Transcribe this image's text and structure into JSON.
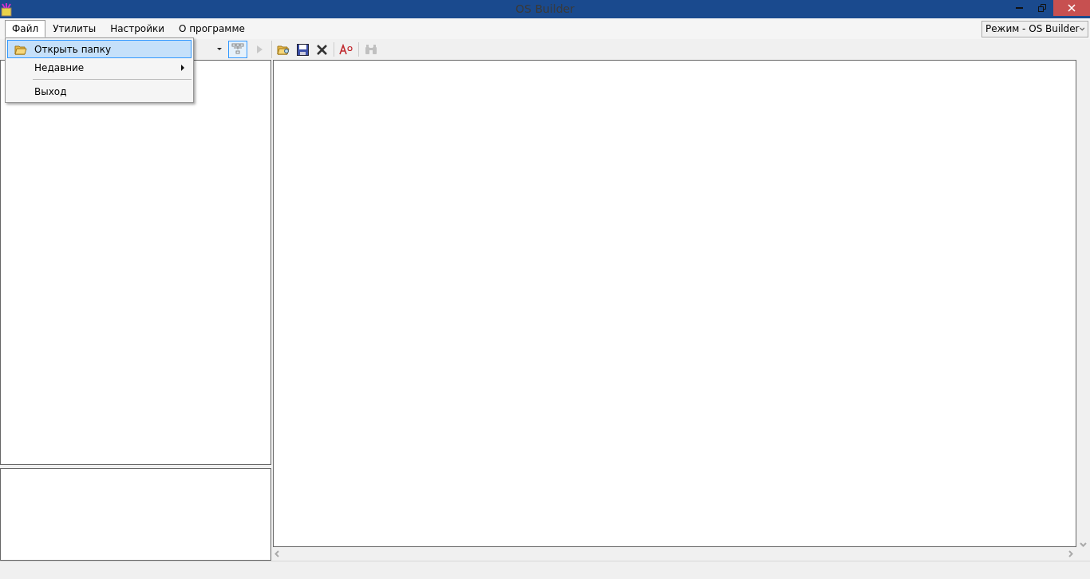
{
  "window": {
    "title": "OS Builder"
  },
  "menu": [
    {
      "label": "Файл",
      "selected": true
    },
    {
      "label": "Утилиты",
      "selected": false
    },
    {
      "label": "Настройки",
      "selected": false
    },
    {
      "label": "О программе",
      "selected": false
    }
  ],
  "mode_select": {
    "value": "Режим - OS Builder"
  },
  "file_menu": [
    {
      "kind": "open",
      "label": "Открыть папку",
      "selected": true
    },
    {
      "kind": "submenu",
      "label": "Недавние",
      "selected": false
    },
    {
      "kind": "separator"
    },
    {
      "kind": "item",
      "label": "Выход",
      "selected": false
    }
  ],
  "left_tools": [
    {
      "kind": "tree",
      "checked": true,
      "disabled": false
    },
    {
      "kind": "play",
      "checked": false,
      "disabled": true
    }
  ],
  "editor_tools": [
    {
      "kind": "open",
      "disabled": false
    },
    {
      "kind": "save",
      "disabled": false
    },
    {
      "kind": "delete",
      "disabled": false
    },
    {
      "kind": "sep"
    },
    {
      "kind": "font",
      "disabled": false
    },
    {
      "kind": "sep"
    },
    {
      "kind": "find",
      "disabled": true
    }
  ]
}
